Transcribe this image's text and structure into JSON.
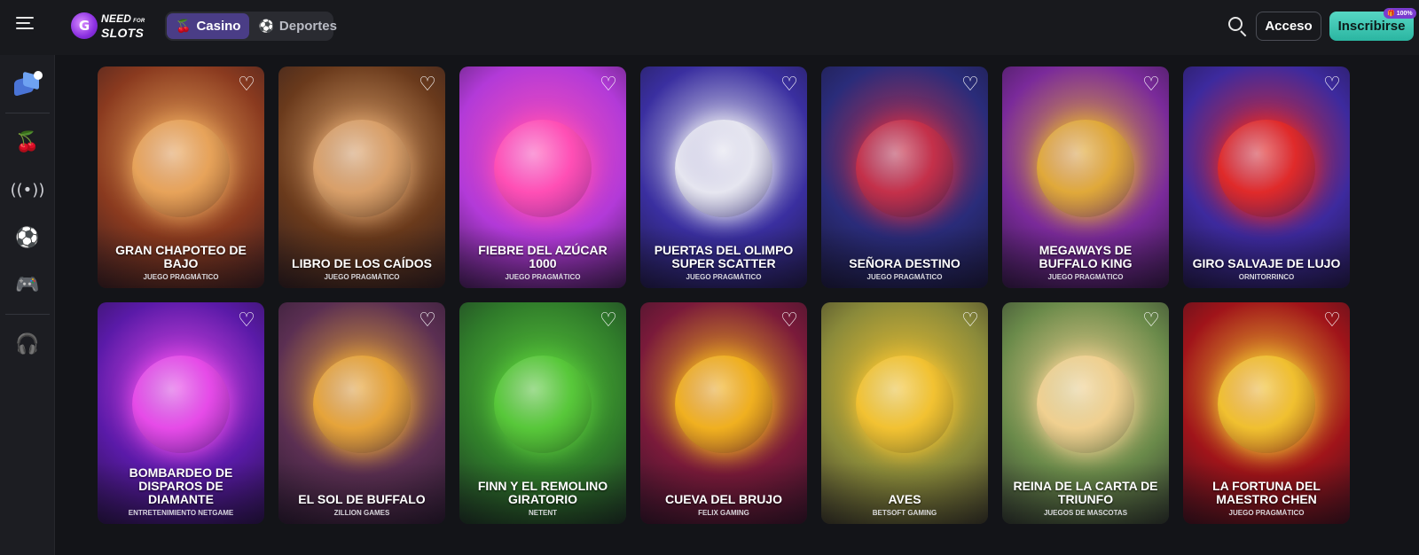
{
  "header": {
    "logo_line1": "NEED",
    "logo_line1_small": "FOR",
    "logo_line2": "SLOTS",
    "logo_mark": "G",
    "modes": [
      {
        "label": "Casino",
        "icon": "cherries-icon",
        "active": true
      },
      {
        "label": "Deportes",
        "icon": "soccer-ball-icon",
        "active": false
      }
    ],
    "login_label": "Acceso",
    "signup_label": "Inscribirse",
    "signup_badge": "100%"
  },
  "sidebar": {
    "items": [
      {
        "name": "promotions",
        "icon": "promo-cubes-icon"
      },
      {
        "name": "casino",
        "icon": "cherries-icon"
      },
      {
        "name": "live",
        "icon": "broadcast-icon"
      },
      {
        "name": "sports",
        "icon": "soccer-ball-icon"
      },
      {
        "name": "games",
        "icon": "gamepad-icon"
      },
      {
        "name": "support",
        "icon": "headset-icon"
      }
    ]
  },
  "games": [
    {
      "title": "GRAN CHAPOTEO DE BAJO",
      "provider": "JUEGO PRAGMÁTICO",
      "bg": "#8a3a1f",
      "accent": "#e7a35a"
    },
    {
      "title": "LIBRO DE LOS CAÍDOS",
      "provider": "JUEGO PRAGMÁTICO",
      "bg": "#6a3a1c",
      "accent": "#d9a06a"
    },
    {
      "title": "FIEBRE DEL AZÚCAR 1000",
      "provider": "JUEGO PRAGMÁTICO",
      "bg": "#b23ad8",
      "accent": "#ff4fb5"
    },
    {
      "title": "PUERTAS DEL OLIMPO SUPER SCATTER",
      "provider": "JUEGO PRAGMÁTICO",
      "bg": "#3a2fa0",
      "accent": "#e6e6f0"
    },
    {
      "title": "SEÑORA DESTINO",
      "provider": "JUEGO PRAGMÁTICO",
      "bg": "#2a2c7a",
      "accent": "#c4304a"
    },
    {
      "title": "MEGAWAYS DE BUFFALO KING",
      "provider": "JUEGO PRAGMÁTICO",
      "bg": "#7a2a9a",
      "accent": "#e0a93a"
    },
    {
      "title": "GIRO SALVAJE DE LUJO",
      "provider": "ORNITORRINCO",
      "bg": "#3d2a9e",
      "accent": "#e02a2a"
    },
    {
      "title": "BOMBARDEO DE DISPAROS DE DIAMANTE",
      "provider": "ENTRETENIMIENTO NETGAME",
      "bg": "#5a1aa8",
      "accent": "#e64be8"
    },
    {
      "title": "EL SOL DE BUFFALO",
      "provider": "ZILLION GAMES",
      "bg": "#5b2f52",
      "accent": "#e6a43a"
    },
    {
      "title": "FINN Y EL REMOLINO GIRATORIO",
      "provider": "NETENT",
      "bg": "#2f7a2a",
      "accent": "#58c83a"
    },
    {
      "title": "CUEVA DEL BRUJO",
      "provider": "FELIX GAMING",
      "bg": "#7a1a3a",
      "accent": "#f0b020"
    },
    {
      "title": "AVES",
      "provider": "BETSOFT GAMING",
      "bg": "#8a8a3a",
      "accent": "#f2c232"
    },
    {
      "title": "REINA DE LA CARTA DE TRIUNFO",
      "provider": "JUEGOS DE MASCOTAS",
      "bg": "#6a8a4a",
      "accent": "#f0d090"
    },
    {
      "title": "LA FORTUNA DEL MAESTRO CHEN",
      "provider": "JUEGO PRAGMÁTICO",
      "bg": "#a0141a",
      "accent": "#f0c030"
    }
  ]
}
